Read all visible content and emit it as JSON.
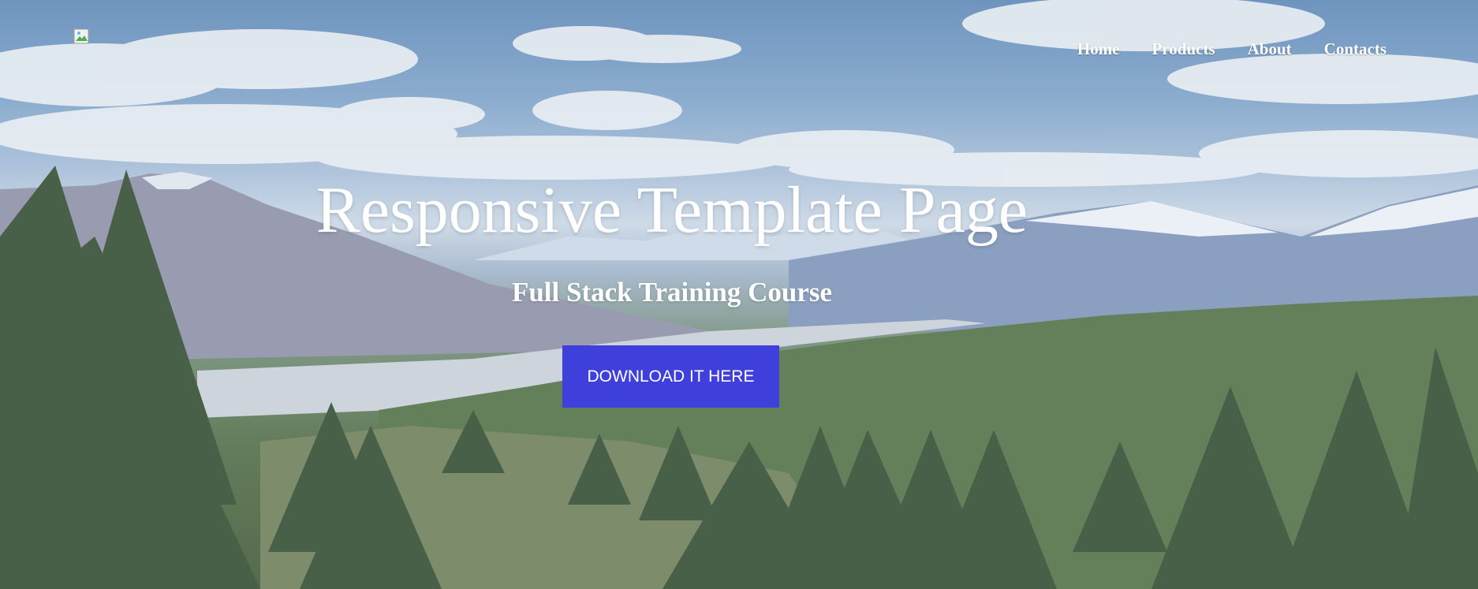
{
  "logo": {
    "icon": "broken-image-icon"
  },
  "nav": {
    "items": [
      {
        "label": "Home"
      },
      {
        "label": "Products"
      },
      {
        "label": "About"
      },
      {
        "label": "Contacts"
      }
    ]
  },
  "hero": {
    "title": "Responsive Template Page",
    "subtitle": "Full Stack Training Course",
    "cta_label": "DOWNLOAD IT HERE",
    "background": "mountain-forest-landscape",
    "colors": {
      "accent": "#3f3fdc",
      "text": "#ffffff"
    }
  }
}
